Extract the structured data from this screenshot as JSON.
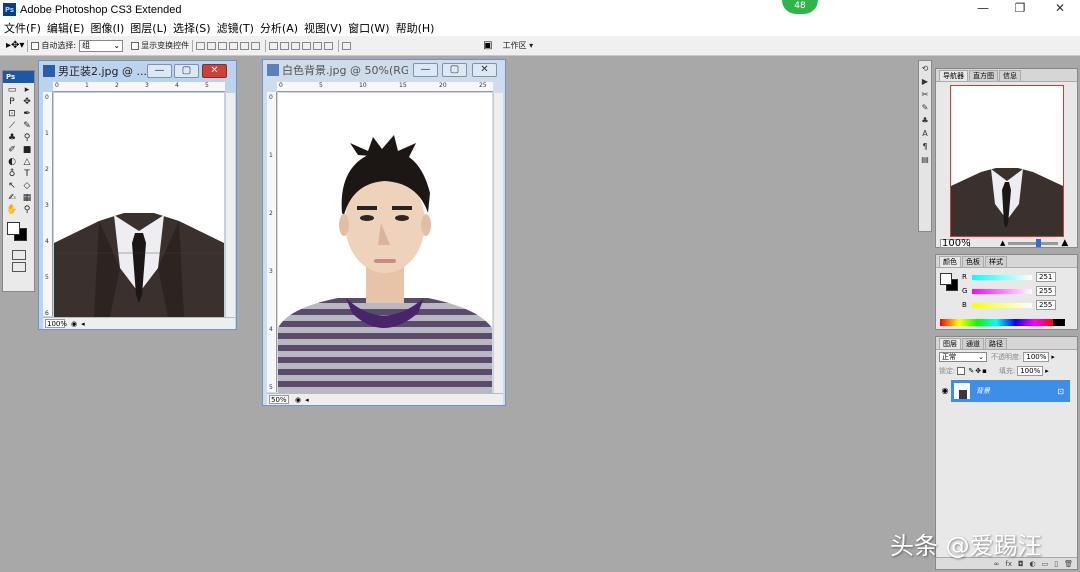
{
  "app": {
    "title": "Adobe Photoshop CS3 Extended",
    "logo_text": "Ps",
    "notification_count": "48"
  },
  "window_controls": {
    "minimize": "—",
    "restore": "❐",
    "close": "✕"
  },
  "menu": [
    "文件(F)",
    "编辑(E)",
    "图像(I)",
    "图层(L)",
    "选择(S)",
    "滤镜(T)",
    "分析(A)",
    "视图(V)",
    "窗口(W)",
    "帮助(H)"
  ],
  "options_bar": {
    "auto_select_label": "自动选择:",
    "auto_select_value": "组",
    "show_transform_label": "显示变换控件",
    "workspace_label": "工作区 ▾"
  },
  "toolbox": {
    "header": "Ps",
    "tools": [
      "▭",
      "▸",
      "P",
      "✥",
      "⊡",
      "✒",
      "⟋",
      "✎",
      "♣",
      "⚲",
      "✐",
      "■",
      "◐",
      "△",
      "♁",
      "T",
      "↖",
      "◇",
      "✍",
      "▦",
      "✋",
      "⚲"
    ]
  },
  "doc1": {
    "title": "男正装2.jpg @ ...",
    "zoom": "100%",
    "ruler_numbers": [
      "0",
      "1",
      "2",
      "3",
      "4",
      "5"
    ],
    "vruler_numbers": [
      "0",
      "1",
      "2",
      "3",
      "4",
      "5",
      "6"
    ]
  },
  "doc2": {
    "title": "白色背景.jpg @ 50%(RG...",
    "zoom": "50%",
    "ruler_numbers": [
      "0",
      "5",
      "10",
      "15",
      "20",
      "25"
    ],
    "vruler_numbers": [
      "0",
      "1",
      "2",
      "3",
      "4",
      "5"
    ]
  },
  "navigator": {
    "tabs": [
      "导航器",
      "直方图",
      "信息"
    ],
    "zoom": "100%"
  },
  "color_panel": {
    "tabs": [
      "颜色",
      "色板",
      "样式"
    ],
    "channels": [
      {
        "label": "R",
        "value": "251"
      },
      {
        "label": "G",
        "value": "255"
      },
      {
        "label": "B",
        "value": "255"
      }
    ]
  },
  "layers_panel": {
    "tabs": [
      "图层",
      "通道",
      "路径"
    ],
    "blend_mode": "正常",
    "opacity_label": "不透明度:",
    "opacity_value": "100%",
    "lock_label": "锁定:",
    "fill_label": "填充:",
    "fill_value": "100%",
    "layer_name": "背景"
  },
  "watermark": "头条 @爱踢汪"
}
